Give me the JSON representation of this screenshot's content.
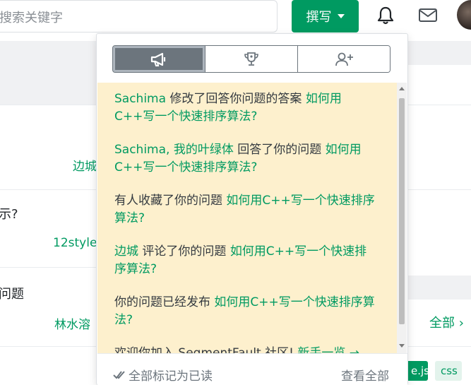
{
  "header": {
    "search_placeholder": "搜索关键字",
    "write_label": "撰写"
  },
  "background": {
    "frag1": "边城",
    "frag2": "示?",
    "frag3": "12style",
    "frag4": "问题",
    "frag5": "林水溶",
    "all_label": "全部",
    "tag1": "e.js",
    "tag2": "css"
  },
  "notifications": {
    "tabs": [
      {
        "icon": "megaphone-icon",
        "active": true
      },
      {
        "icon": "trophy-icon",
        "active": false
      },
      {
        "icon": "add-user-icon",
        "active": false
      }
    ],
    "items": [
      {
        "actor": "Sachima",
        "action": " 修改了回答你问题的答案 ",
        "link": "如何用C++写一个快速排序算法?"
      },
      {
        "actor": "Sachima, 我的叶绿体",
        "action": " 回答了你的问题 ",
        "link": "如何用C++写一个快速排序算法?"
      },
      {
        "actor": "",
        "action": "有人收藏了你的问题 ",
        "link": "如何用C++写一个快速排序算法?"
      },
      {
        "actor": "边城",
        "action": " 评论了你的问题 ",
        "link": "如何用C++写一个快速排序算法?"
      },
      {
        "actor": "",
        "action": "你的问题已经发布 ",
        "link": "如何用C++写一个快速排序算法?"
      },
      {
        "actor": "",
        "action": "欢迎你加入 SegmentFault 社区! ",
        "link": "新手一览 →"
      }
    ],
    "mark_all_read": "全部标记为已读",
    "view_all": "查看全部"
  },
  "colors": {
    "brand_green": "#009a61",
    "notice_bg": "#fdf0cd",
    "segment_active": "#6c757d"
  }
}
